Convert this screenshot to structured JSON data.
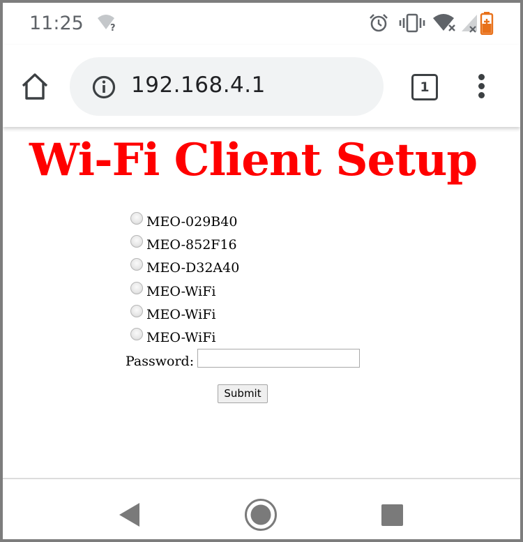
{
  "status_bar": {
    "time": "11:25",
    "wifi_question_icon": "wifi-question-icon",
    "alarm_icon": "alarm-icon",
    "vibrate_icon": "vibrate-icon",
    "wifi_icon": "wifi-off-icon",
    "signal_icon": "signal-icon",
    "battery_icon": "battery-saver-icon"
  },
  "browser": {
    "url": "192.168.4.1",
    "tab_count": "1",
    "home_icon": "home-icon",
    "info_icon": "info-icon",
    "menu_icon": "more-vert-icon"
  },
  "page": {
    "title": "Wi-Fi Client Setup",
    "title_color": "#ff0000",
    "networks": [
      {
        "label": "MEO-029B40",
        "selected": false
      },
      {
        "label": "MEO-852F16",
        "selected": false
      },
      {
        "label": "MEO-D32A40",
        "selected": false
      },
      {
        "label": "MEO-WiFi",
        "selected": false
      },
      {
        "label": "MEO-WiFi",
        "selected": false
      },
      {
        "label": "MEO-WiFi",
        "selected": false
      }
    ],
    "password_label": "Password:",
    "password_value": "",
    "submit_label": "Submit"
  },
  "nav_bar": {
    "back_icon": "back-triangle-icon",
    "home_icon": "home-circle-icon",
    "recents_icon": "recents-square-icon"
  }
}
